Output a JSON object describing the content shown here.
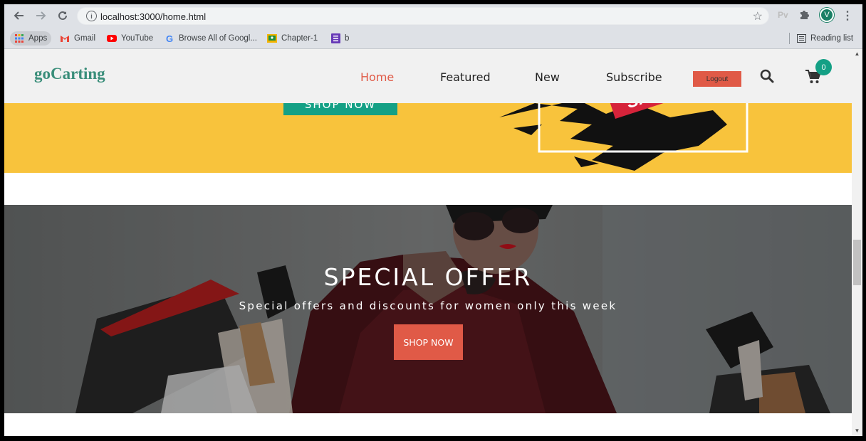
{
  "browser": {
    "url": "localhost:3000/home.html",
    "bookmarks": [
      "Apps",
      "Gmail",
      "YouTube",
      "Browse All of Googl...",
      "Chapter-1",
      "b"
    ],
    "reading_list": "Reading list",
    "profile_initial": "V",
    "extension_label": "Pv"
  },
  "site": {
    "logo": "goCarting",
    "nav": [
      "Home",
      "Featured",
      "New",
      "Subscribe"
    ],
    "logout": "Logout",
    "cart_count": "0",
    "accent_color": "#e05a47",
    "teal_color": "#14a085"
  },
  "banner": {
    "shop_now": "SHOP NOW",
    "sale_text": "SALE",
    "background": "#f8c33c"
  },
  "hero": {
    "title": "SPECIAL OFFER",
    "subtitle": "Special offers and discounts for women only this week",
    "button": "SHOP NOW"
  }
}
